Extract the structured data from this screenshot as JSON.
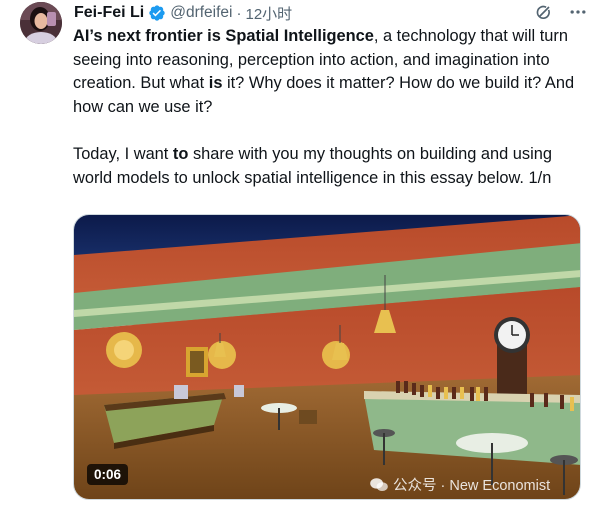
{
  "author": {
    "name": "Fei-Fei Li",
    "handle": "@drfeifei",
    "separator": "·",
    "time": "12小时"
  },
  "tweet": {
    "p1": {
      "bold1": "AI’s next frontier is Spatial Intelligence",
      "t1": ", a technology that will turn seeing into reasoning, perception into action, and imagination into creation. But what ",
      "bold2": "is",
      "t2": " it? Why does it matter? How do we build it? And how can we use it?"
    },
    "p2": {
      "t1": "Today, I want ",
      "bold1": "to",
      "t2": " share with you my thoughts on building and using world models to unlock spatial intelligence in this essay below. 1/n"
    }
  },
  "media": {
    "duration": "0:06",
    "watermark": "公众号 · New Economist"
  },
  "icons": {
    "verified": "verified-badge-icon",
    "grok": "grok-icon",
    "more": "more-icon"
  },
  "colors": {
    "verified": "#1d9bf0",
    "secondary_text": "#536471"
  }
}
